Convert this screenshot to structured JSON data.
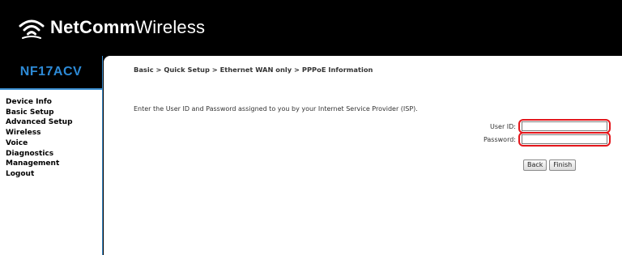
{
  "header": {
    "brand_strong": "NetComm",
    "brand_light": "Wireless",
    "logo_icon": "wifi-signal-icon"
  },
  "sidebar": {
    "model": "NF17ACV",
    "items": [
      {
        "label": "Device Info"
      },
      {
        "label": "Basic Setup"
      },
      {
        "label": "Advanced Setup"
      },
      {
        "label": "Wireless"
      },
      {
        "label": "Voice"
      },
      {
        "label": "Diagnostics"
      },
      {
        "label": "Management"
      },
      {
        "label": "Logout"
      }
    ]
  },
  "main": {
    "breadcrumb": "Basic > Quick Setup > Ethernet WAN only > PPPoE Information",
    "instruction": "Enter the User ID and Password assigned to you by your Internet Service Provider (ISP).",
    "user_id_label": "User ID:",
    "user_id_value": "",
    "password_label": "Password:",
    "password_value": "",
    "back_label": "Back",
    "finish_label": "Finish"
  },
  "colors": {
    "accent": "#2d8ad6",
    "highlight": "#e3161b",
    "header_bg": "#000000"
  }
}
